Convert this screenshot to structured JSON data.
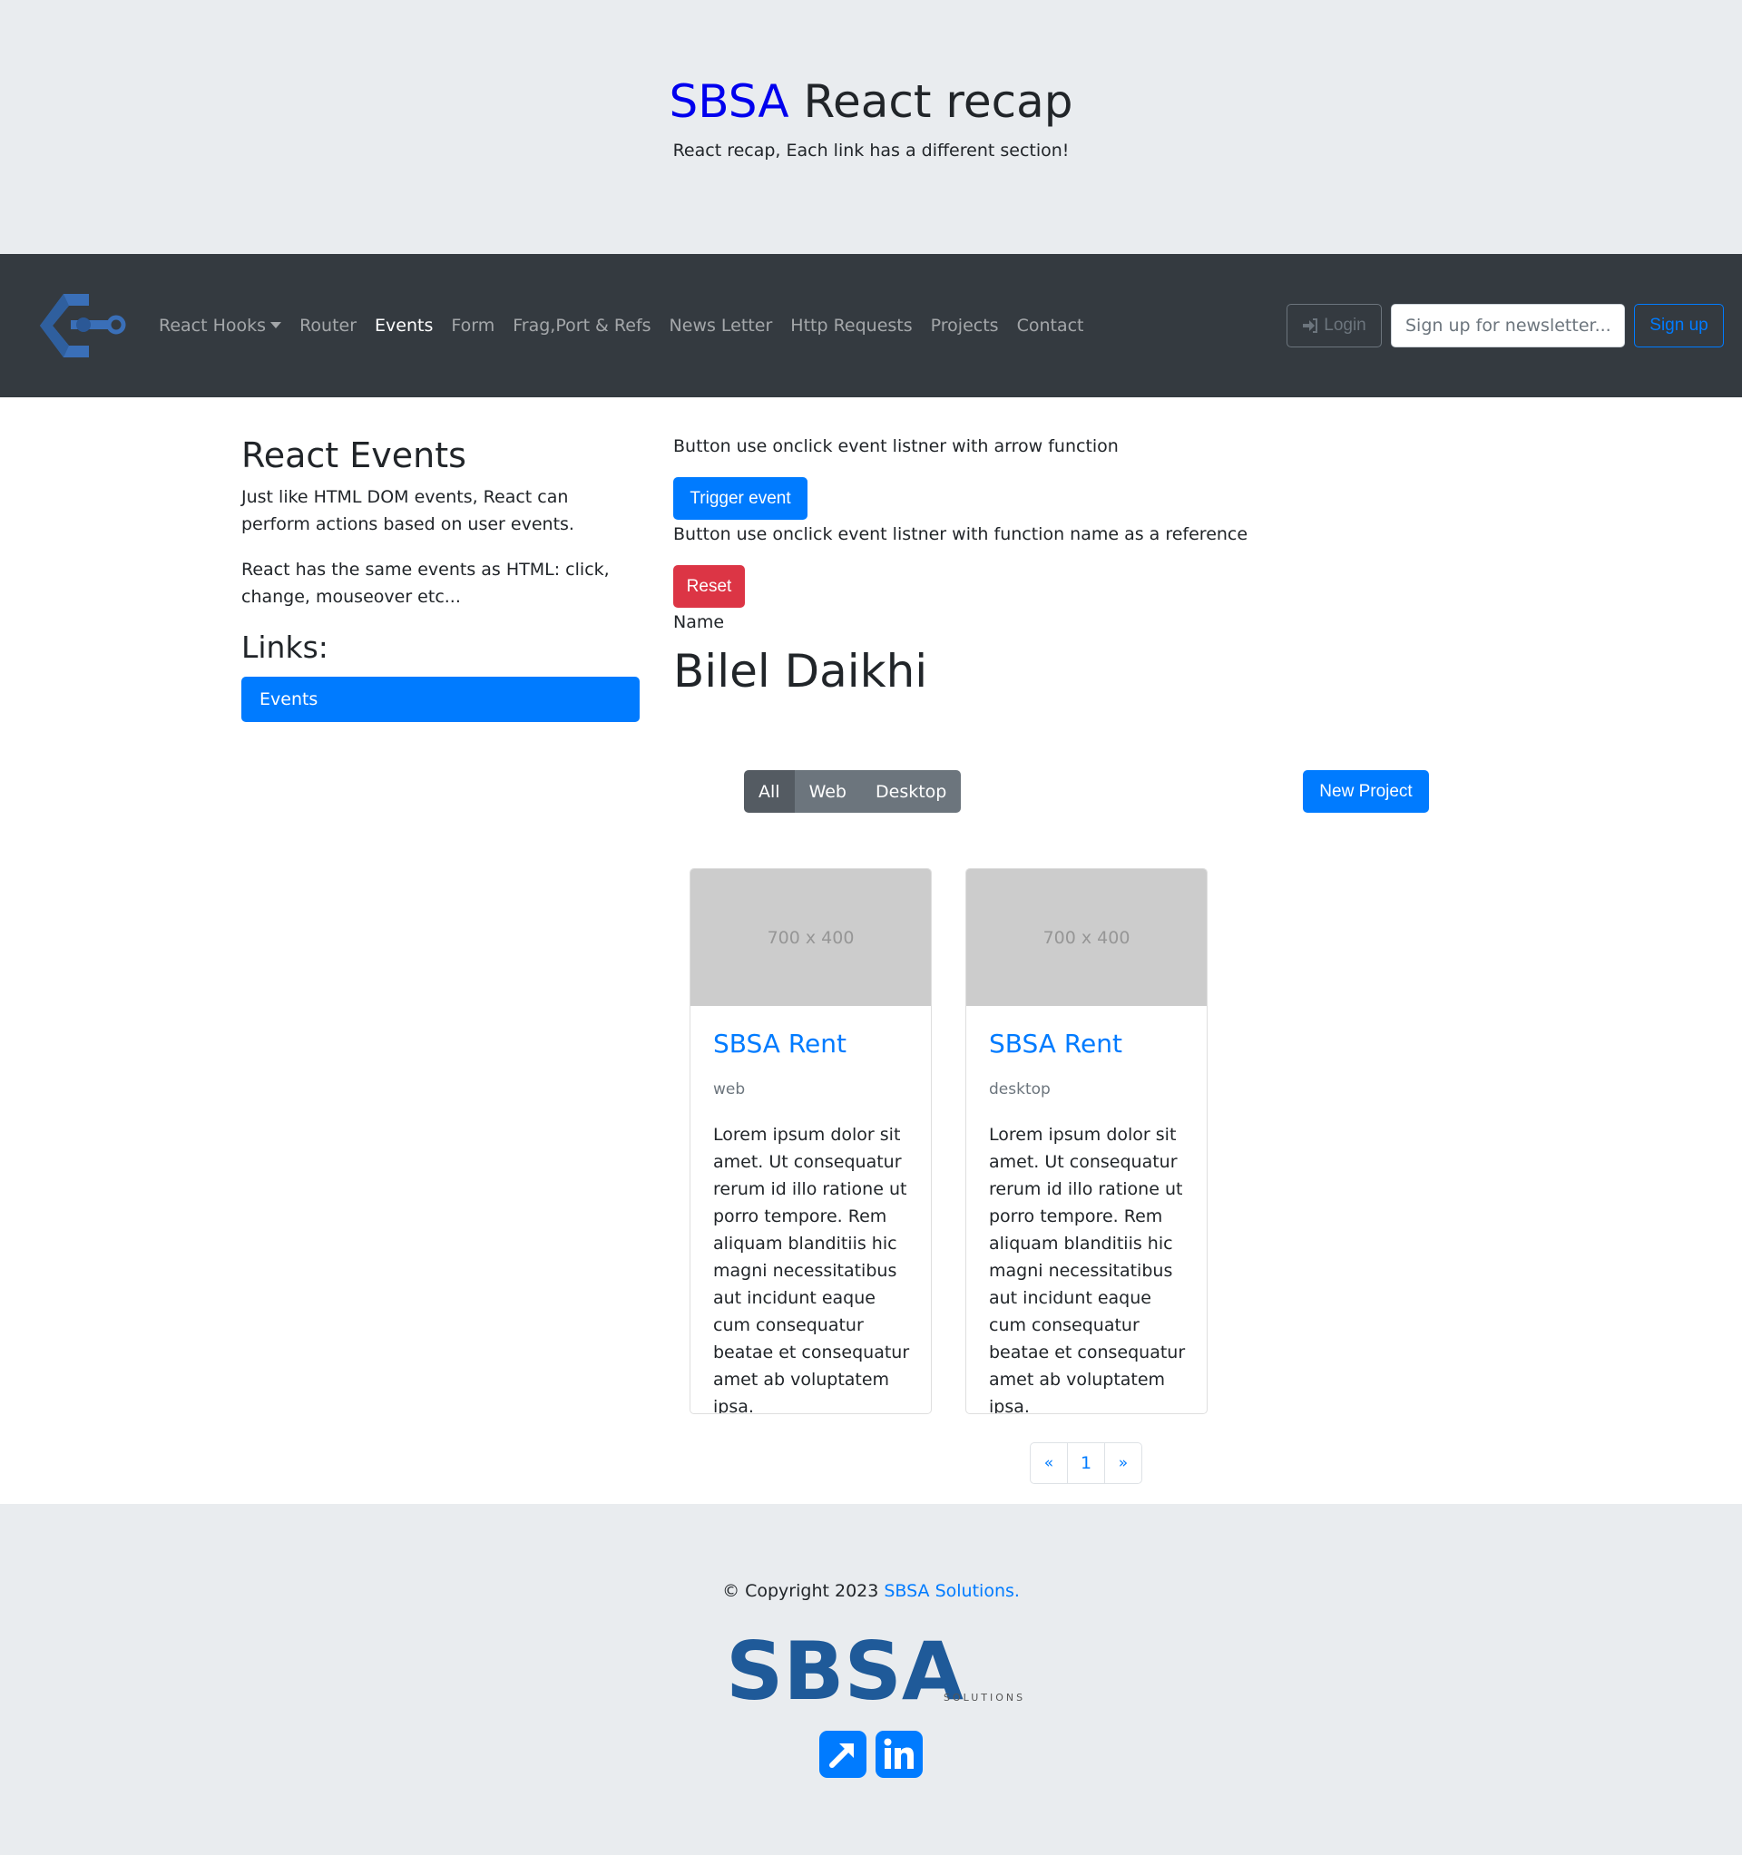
{
  "header": {
    "brand": "SBSA",
    "title_rest": " React recap",
    "subtitle": "React recap, Each link has a different section!"
  },
  "navbar": {
    "items": [
      {
        "label": "React Hooks",
        "dropdown": true
      },
      {
        "label": "Router"
      },
      {
        "label": "Events",
        "active": true
      },
      {
        "label": "Form"
      },
      {
        "label": "Frag,Port & Refs"
      },
      {
        "label": "News Letter"
      },
      {
        "label": "Http Requests"
      },
      {
        "label": "Projects"
      },
      {
        "label": "Contact"
      }
    ],
    "login_label": "Login",
    "newsletter_placeholder": "Sign up for newsletter...",
    "signup_label": "Sign up"
  },
  "sidebar": {
    "heading": "React Events",
    "paragraph1": "Just like HTML DOM events, React can perform actions based on user events.",
    "paragraph2": "React has the same events as HTML: click, change, mouseover etc...",
    "links_heading": "Links:",
    "active_link": "Events"
  },
  "events": {
    "label_arrow": "Button use onclick event listner with arrow function",
    "trigger_label": "Trigger event",
    "label_reference": "Button use onclick event listner with function name as a reference",
    "reset_label": "Reset",
    "name_label": "Name",
    "name_value": "Bilel Daikhi"
  },
  "projects": {
    "filters": [
      "All",
      "Web",
      "Desktop"
    ],
    "active_filter": "All",
    "new_project_label": "New Project",
    "cards": [
      {
        "image_text": "700 x 400",
        "title": "SBSA Rent",
        "category": "web",
        "text": "Lorem ipsum dolor sit amet. Ut consequatur rerum id illo ratione ut porro tempore. Rem aliquam blanditiis hic magni necessitatibus aut incidunt eaque cum consequatur beatae et consequatur amet ab voluptatem ipsa."
      },
      {
        "image_text": "700 x 400",
        "title": "SBSA Rent",
        "category": "desktop",
        "text": "Lorem ipsum dolor sit amet. Ut consequatur rerum id illo ratione ut porro tempore. Rem aliquam blanditiis hic magni necessitatibus aut incidunt eaque cum consequatur beatae et consequatur amet ab voluptatem ipsa."
      }
    ],
    "pagination": {
      "prev": "«",
      "page": "1",
      "next": "»"
    }
  },
  "footer": {
    "copyright": "© Copyright 2023 ",
    "company_link": "SBSA Solutions.",
    "logo_text": "SBSA",
    "logo_sub": "SOLUTIONS",
    "social_icons": [
      "external-link-icon",
      "linkedin-icon"
    ]
  },
  "colors": {
    "primary": "#007bff",
    "danger": "#dc3545",
    "secondary": "#6c757d",
    "navbar": "#343a40",
    "jumbotron": "#e9ecef",
    "brand_blue": "#0000ee",
    "logo_blue": "#1f5a99"
  }
}
